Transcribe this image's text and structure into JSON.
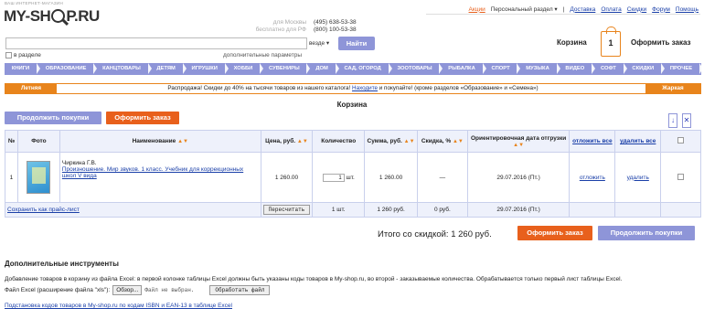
{
  "header": {
    "tagline": "ВАШ ИНТЕРНЕТ-МАГАЗИН",
    "logo_left": "MY-SH",
    "logo_right": "P.RU",
    "phone_label_moscow": "для Москвы",
    "phone_label_rf": "бесплатно для РФ",
    "phone_moscow": "(495) 638-53-38",
    "phone_rf": "(800) 100-53-38",
    "links": {
      "sale": "Акции",
      "personal": "Персональный раздел",
      "delivery": "Доставка",
      "payment": "Оплата",
      "discounts": "Скидки",
      "forum": "Форум",
      "help": "Помощь"
    },
    "search": {
      "value": "",
      "scope": "везде",
      "button": "Найти",
      "in_section": "в разделе",
      "advanced": "дополнительные параметры"
    },
    "cart": {
      "label": "Корзина",
      "count": "1",
      "checkout": "Оформить заказ"
    }
  },
  "nav": [
    "КНИГИ",
    "ОБРАЗОВАНИЕ",
    "КАНЦТОВАРЫ",
    "ДЕТЯМ",
    "ИГРУШКИ",
    "ХОББИ",
    "СУВЕНИРЫ",
    "ДОМ",
    "САД, ОГОРОД",
    "ЗООТОВАРЫ",
    "РЫБАЛКА",
    "СПОРТ",
    "МУЗЫКА",
    "ВИДЕО",
    "СОФТ",
    "СКИДКИ",
    "ПРОЧЕЕ"
  ],
  "promo": {
    "left": "Летняя",
    "text_before": "Распродажа! Скидки до 40% на тысячи товаров из нашего каталога!",
    "link": "Находите",
    "text_after": "и покупайте! (кроме разделов «Образование» и «Семена»)",
    "right": "Жаркая"
  },
  "page_title": "Корзина",
  "buttons": {
    "continue": "Продолжить покупки",
    "checkout": "Оформить заказ"
  },
  "icons": {
    "download": "↓",
    "delete": "✕"
  },
  "table": {
    "headers": {
      "num": "№",
      "photo": "Фото",
      "name": "Наименование",
      "price": "Цена, руб.",
      "qty": "Количество",
      "sum": "Сумма, руб.",
      "discount": "Скидка, %",
      "ship_date": "Ориентировочная дата отгрузки",
      "postpone": "отложить все",
      "delete": "удалить все"
    },
    "rows": [
      {
        "num": "1",
        "author": "Чиркина Г.В.",
        "title": "Произношение. Мир звуков. 1 класс. Учебник для коррекционных школ V вида",
        "price": "1 260.00",
        "qty": "1",
        "unit": "шт.",
        "sum": "1 260.00",
        "discount": "—",
        "ship_date": "29.07.2016 (Пт.)",
        "postpone": "отложить",
        "delete": "удалить"
      }
    ],
    "footer": {
      "save_link": "Сохранить как прайс-лист",
      "recalc": "Пересчитать",
      "qty_total": "1 шт.",
      "sum_total": "1 260 руб.",
      "discount_total": "0 руб.",
      "ship_total": "29.07.2016 (Пт.)"
    }
  },
  "total": "Итого со скидкой: 1 260 руб.",
  "extra": {
    "title": "Дополнительные инструменты",
    "description": "Добавление товаров в корзину из файла Excel: в первой колонке таблицы Excel должны быть указаны коды товаров в My-shop.ru, во второй - заказываемые количества. Обрабатывается только первый лист таблицы Excel.",
    "file_label": "Файл Excel (расширение файла \"xls\"):",
    "browse": "Обзор...",
    "no_file": "Файл не выбран.",
    "process": "Обработать файл",
    "isbn_link": "Подстановка кодов товаров в My-shop.ru по кодам ISBN и EAN-13 в таблице Excel"
  },
  "colors": {
    "accent_blue": "#8e95d8",
    "accent_orange": "#e8601c"
  }
}
